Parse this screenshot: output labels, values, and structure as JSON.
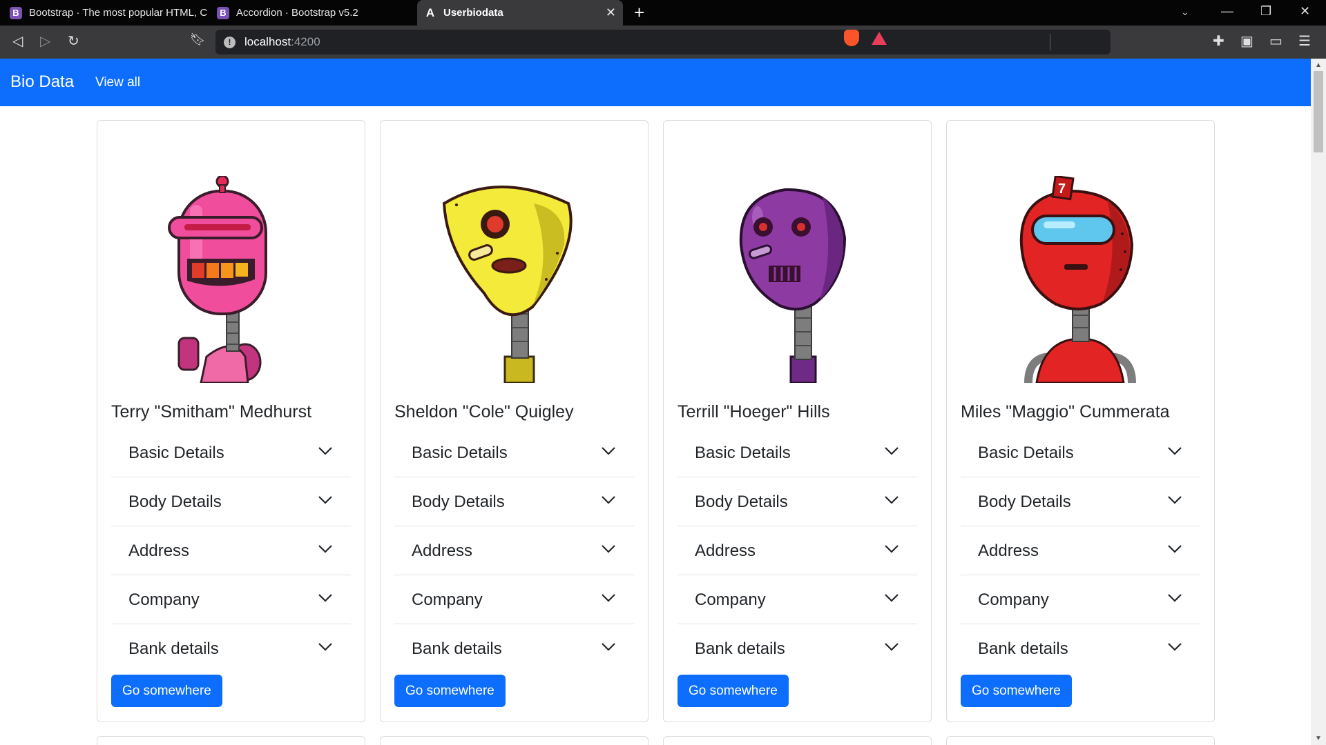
{
  "browser": {
    "tabs": [
      {
        "label": "Bootstrap · The most popular HTML, C",
        "favicon": "B"
      },
      {
        "label": "Accordion · Bootstrap v5.2",
        "favicon": "B"
      },
      {
        "label": "Userbiodata",
        "favicon": "A"
      }
    ],
    "url_host": "localhost",
    "url_port": ":4200"
  },
  "navbar": {
    "brand": "Bio Data",
    "link": "View all"
  },
  "sections": [
    "Basic Details",
    "Body Details",
    "Address",
    "Company",
    "Bank details"
  ],
  "button_label": "Go somewhere",
  "cards": [
    {
      "name": "Terry \"Smitham\" Medhurst",
      "robot_color": "#f54da0"
    },
    {
      "name": "Sheldon \"Cole\" Quigley",
      "robot_color": "#f3ea3a"
    },
    {
      "name": "Terrill \"Hoeger\" Hills",
      "robot_color": "#8e3aa3"
    },
    {
      "name": "Miles \"Maggio\" Cummerata",
      "robot_color": "#e32424"
    }
  ],
  "colors": {
    "primary": "#0d6efd",
    "chrome_dark": "#050505",
    "toolbar": "#3a3a3d"
  }
}
